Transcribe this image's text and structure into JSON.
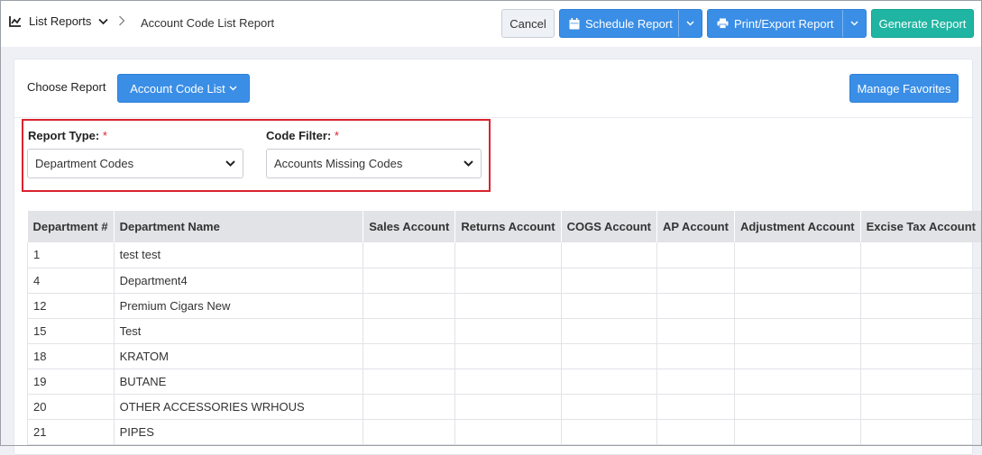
{
  "header": {
    "nav_label": "List Reports",
    "current_page": "Account Code List Report",
    "cancel_label": "Cancel",
    "schedule_label": "Schedule Report",
    "print_label": "Print/Export Report",
    "generate_label": "Generate Report"
  },
  "chooser": {
    "label": "Choose Report",
    "selected": "Account Code List",
    "favorites_label": "Manage Favorites"
  },
  "filters": {
    "report_type_label": "Report Type:",
    "report_type_value": "Department Codes",
    "code_filter_label": "Code Filter:",
    "code_filter_value": "Accounts Missing Codes",
    "required_mark": "*"
  },
  "table": {
    "columns": [
      "Department #",
      "Department Name",
      "Sales Account",
      "Returns Account",
      "COGS Account",
      "AP Account",
      "Adjustment Account",
      "Excise Tax Account"
    ],
    "rows": [
      [
        "1",
        "test test",
        "",
        "",
        "",
        "",
        "",
        ""
      ],
      [
        "4",
        "Department4",
        "",
        "",
        "",
        "",
        "",
        ""
      ],
      [
        "12",
        "Premium Cigars New",
        "",
        "",
        "",
        "",
        "",
        ""
      ],
      [
        "15",
        "Test",
        "",
        "",
        "",
        "",
        "",
        ""
      ],
      [
        "18",
        "KRATOM",
        "",
        "",
        "",
        "",
        "",
        ""
      ],
      [
        "19",
        "BUTANE",
        "",
        "",
        "",
        "",
        "",
        ""
      ],
      [
        "20",
        "OTHER ACCESSORIES WRHOUS",
        "",
        "",
        "",
        "",
        "",
        ""
      ],
      [
        "21",
        "PIPES",
        "",
        "",
        "",
        "",
        "",
        ""
      ]
    ]
  },
  "colors": {
    "primary": "#3a8ee6",
    "generate": "#1fb5a2",
    "highlight": "#d9232e"
  }
}
